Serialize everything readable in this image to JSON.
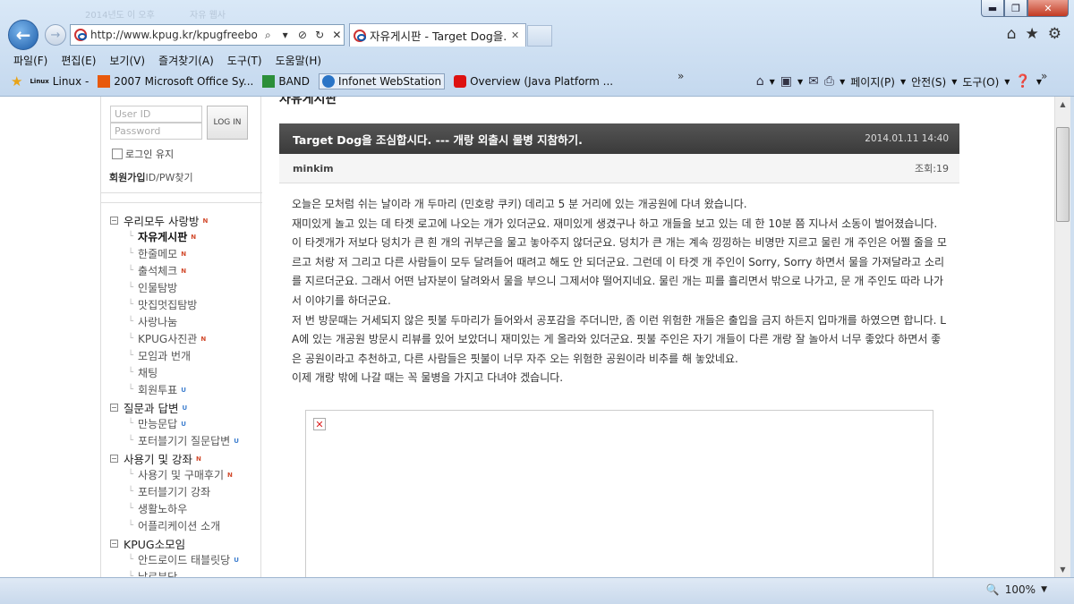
{
  "browser": {
    "ghost_tabs": [
      "2014년도 이 오후",
      "자유 웹사"
    ],
    "address": "http://www.kpug.kr/kpugfreeboard/",
    "tab_title": "자유게시판 - Target Dog을...",
    "menu": [
      "파일(F)",
      "편집(E)",
      "보기(V)",
      "즐겨찾기(A)",
      "도구(T)",
      "도움말(H)"
    ],
    "favorites": [
      "Linux -",
      "2007 Microsoft Office Sy...",
      "BAND",
      "Infonet WebStation",
      "Overview (Java Platform ..."
    ],
    "linux_badge": "Linux",
    "commands": {
      "page": "페이지(P)",
      "safety": "안전(S)",
      "tools": "도구(O)"
    },
    "zoom": "100%"
  },
  "login": {
    "user_placeholder": "User ID",
    "password_placeholder": "Password",
    "login_button": "LOG IN",
    "remember": "로그인 유지",
    "join": "회원가입",
    "find": "ID/PW찾기"
  },
  "sidebar": {
    "items": [
      {
        "label": "우리모두 사랑방",
        "badge": "N"
      },
      {
        "label": "자유게시판",
        "badge": "N"
      },
      {
        "label": "한줄메모",
        "badge": "N"
      },
      {
        "label": "출석체크",
        "badge": "N"
      },
      {
        "label": "인물탐방",
        "badge": ""
      },
      {
        "label": "맛집멋집탐방",
        "badge": ""
      },
      {
        "label": "사랑나눔",
        "badge": ""
      },
      {
        "label": "KPUG사진관",
        "badge": "N"
      },
      {
        "label": "모임과 번개",
        "badge": ""
      },
      {
        "label": "채팅",
        "badge": ""
      },
      {
        "label": "회원투표",
        "badge": "U"
      },
      {
        "label": "질문과 답변",
        "badge": "U"
      },
      {
        "label": "만능문답",
        "badge": "U"
      },
      {
        "label": "포터블기기 질문답변",
        "badge": "U"
      },
      {
        "label": "사용기 및 강좌",
        "badge": "N"
      },
      {
        "label": "사용기 및 구매후기",
        "badge": "N"
      },
      {
        "label": "포터블기기 강좌",
        "badge": ""
      },
      {
        "label": "생활노하우",
        "badge": ""
      },
      {
        "label": "어플리케이션 소개",
        "badge": ""
      },
      {
        "label": "KPUG소모임",
        "badge": ""
      },
      {
        "label": "안드로이드 태블릿당",
        "badge": "U"
      },
      {
        "label": "날로분당",
        "badge": ""
      }
    ]
  },
  "post": {
    "board_title": "자유게시판",
    "title": "Target Dog을 조심합시다. --- 개랑 외출시 물병 지참하기.",
    "date": "2014.01.11 14:40",
    "author": "minkim",
    "views": "조회:19",
    "paragraphs": [
      "오늘은 모처럼 쉬는 날이라 개 두마리 (민호랑 쿠키) 데리고 5 분 거리에 있는 개공원에 다녀 왔습니다.",
      "재미있게 놀고 있는 데 타겟 로고에 나오는 개가 있더군요. 재미있게 생겼구나 하고 개들을 보고 있는 데 한 10분 쯤 지나서 소동이 벌어졌습니다. 이 타겟개가 저보다 덩치가 큰 흰 개의 귀부근을 물고 놓아주지 않더군요. 덩치가 큰 개는 계속 낑낑하는 비명만 지르고 물린 개 주인은 어쩔 줄을 모르고 처랑 저 그리고 다른 사람들이 모두 달려들어 때려고 해도 안 되더군요. 그런데 이 타겟 개 주인이 Sorry, Sorry 하면서 물을 가져달라고 소리를 지르더군요. 그래서 어떤 남자분이 달려와서 물을 부으니 그제서야 떨어지네요. 물린 개는 피를 흘리면서 밖으로 나가고, 문 개 주인도 따라 나가서 이야기를 하더군요.",
      "저 번 방문때는 거세되지 않은 핏불 두마리가 들어와서 공포감을 주더니만, 좀 이런 위험한 개들은 출입을 금지 하든지 입마개를 하였으면 합니다. LA에 있는 개공원 방문시 리뷰를 있어 보았더니 재미있는 게 올라와 있더군요. 핏불 주인은 자기 개들이 다른 개랑 잘 놀아서 너무 좋았다 하면서 좋은 공원이라고 추천하고, 다른 사람들은 핏불이 너무 자주 오는 위험한 공원이라 비추를 해 놓았네요.",
      "이제 개랑 밖에 나갈 때는 꼭 물병을 가지고 다녀야 겠습니다."
    ]
  }
}
